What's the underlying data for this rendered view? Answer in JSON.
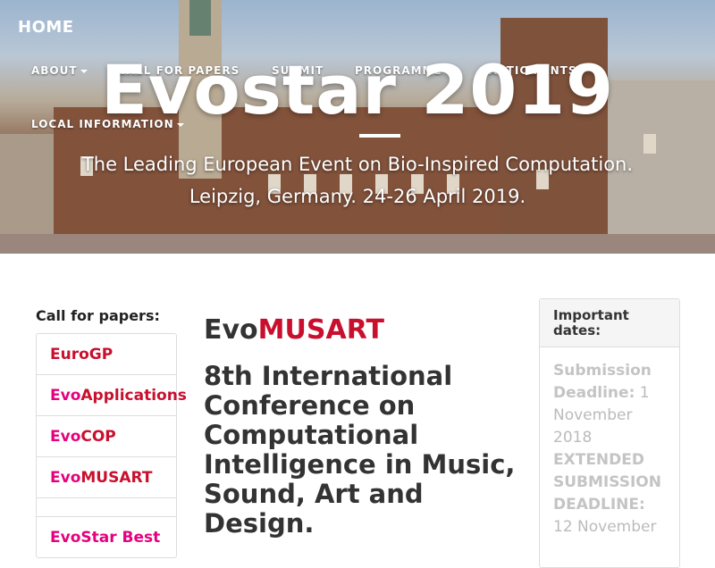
{
  "nav": {
    "home": "HOME",
    "items": [
      {
        "label": "ABOUT",
        "dropdown": true
      },
      {
        "label": "CALL FOR PAPERS",
        "dropdown": false
      },
      {
        "label": "SUBMIT",
        "dropdown": false
      },
      {
        "label": "PROGRAMME",
        "dropdown": false
      },
      {
        "label": "PARTICIPANTS",
        "dropdown": false
      },
      {
        "label": "LOCAL INFORMATION",
        "dropdown": true
      }
    ]
  },
  "hero": {
    "title": "Evostar 2019",
    "subtitle_line1": "The Leading European Event on Bio-Inspired Computation.",
    "subtitle_line2": "Leipzig, Germany. 24-26 April 2019."
  },
  "sidebar": {
    "title": "Call for papers:",
    "items": [
      {
        "prefix": "Euro",
        "suffix": "GP"
      },
      {
        "prefix": "Evo",
        "suffix": "Applications"
      },
      {
        "prefix": "Evo",
        "suffix": "COP"
      },
      {
        "prefix": "Evo",
        "suffix": "MUSART"
      }
    ],
    "extra_item": "EvoStar Best"
  },
  "main": {
    "kicker_prefix": "Evo",
    "kicker_suffix": "MUSART",
    "title": "8th International Conference on Computational Intelligence in Music, Sound, Art and Design."
  },
  "important_dates": {
    "title": "Important dates:",
    "submission_label": "Submission Deadline:",
    "submission_value": "1 November 2018",
    "extended_label": "EXTENDED SUBMISSION DEADLINE:",
    "extended_value": "12 November"
  },
  "colors": {
    "evo_pink": "#e6007e",
    "brand_red": "#c8102e"
  }
}
